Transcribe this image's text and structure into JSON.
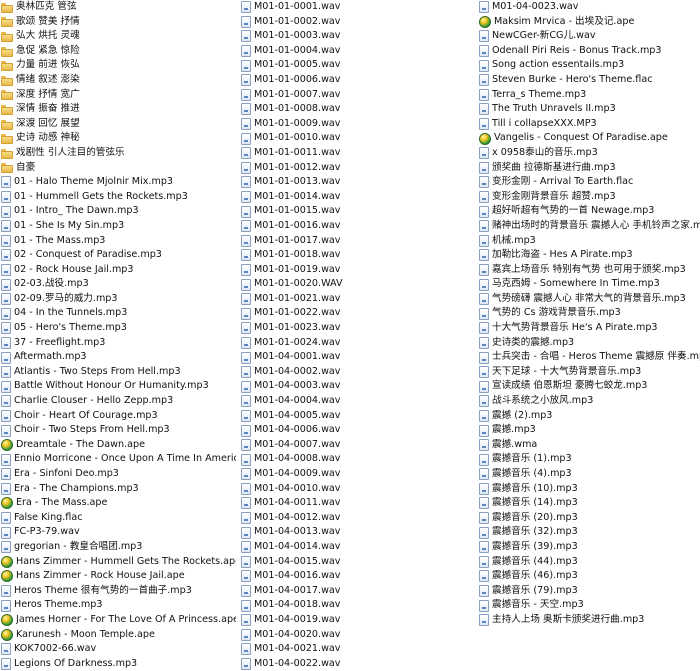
{
  "icons": {
    "folder": "folder-icon",
    "file": "audio-file-icon",
    "ball": "media-player-file-icon"
  },
  "columns": [
    [
      {
        "label": "奥林匹克 管弦",
        "icon": "folder"
      },
      {
        "label": "歌颂 赞美 抒情",
        "icon": "folder"
      },
      {
        "label": "弘大 烘托 灵魂",
        "icon": "folder"
      },
      {
        "label": "急促 紧急 惊险",
        "icon": "folder"
      },
      {
        "label": "力量 前进 恢弘",
        "icon": "folder"
      },
      {
        "label": "情绪 叙述 澎染",
        "icon": "folder"
      },
      {
        "label": "深度 抒情 宽广",
        "icon": "folder"
      },
      {
        "label": "深情 振奋 推进",
        "icon": "folder"
      },
      {
        "label": "深渡 回忆 展望",
        "icon": "folder"
      },
      {
        "label": "史诗 动感 神秘",
        "icon": "folder"
      },
      {
        "label": "戏剧性 引人注目的管弦乐",
        "icon": "folder"
      },
      {
        "label": "自豪",
        "icon": "folder"
      },
      {
        "label": "01 - Halo Theme Mjolnir Mix.mp3",
        "icon": "file"
      },
      {
        "label": "01 - Hummell Gets the Rockets.mp3",
        "icon": "file"
      },
      {
        "label": "01 - Intro_ The Dawn.mp3",
        "icon": "file"
      },
      {
        "label": "01 - She Is My Sin.mp3",
        "icon": "file"
      },
      {
        "label": "01 - The Mass.mp3",
        "icon": "file"
      },
      {
        "label": "02 - Conquest of Paradise.mp3",
        "icon": "file"
      },
      {
        "label": "02 - Rock House Jail.mp3",
        "icon": "file"
      },
      {
        "label": "02-03.战役.mp3",
        "icon": "file"
      },
      {
        "label": "02-09.罗马的威力.mp3",
        "icon": "file"
      },
      {
        "label": "04 - In the Tunnels.mp3",
        "icon": "file"
      },
      {
        "label": "05 - Hero's Theme.mp3",
        "icon": "file"
      },
      {
        "label": "37 - Freeflight.mp3",
        "icon": "file"
      },
      {
        "label": "Aftermath.mp3",
        "icon": "file"
      },
      {
        "label": "Atlantis - Two Steps From Hell.mp3",
        "icon": "file"
      },
      {
        "label": "Battle Without Honour Or Humanity.mp3",
        "icon": "file"
      },
      {
        "label": "Charlie Clouser - Hello Zepp.mp3",
        "icon": "file"
      },
      {
        "label": "Choir - Heart Of Courage.mp3",
        "icon": "file"
      },
      {
        "label": "Choir - Two Steps From Hell.mp3",
        "icon": "file"
      },
      {
        "label": "Dreamtale - The Dawn.ape",
        "icon": "ball"
      },
      {
        "label": "Ennio Morricone - Once Upon A Time In America.mp3",
        "icon": "file"
      },
      {
        "label": "Era - Sinfoni Deo.mp3",
        "icon": "file"
      },
      {
        "label": "Era - The Champions.mp3",
        "icon": "file"
      },
      {
        "label": "Era - The Mass.ape",
        "icon": "ball"
      },
      {
        "label": "False King.flac",
        "icon": "file"
      },
      {
        "label": "FC-P3-79.wav",
        "icon": "file"
      },
      {
        "label": "gregorian - 教皇合唱团.mp3",
        "icon": "file"
      },
      {
        "label": "Hans Zimmer - Hummell Gets The Rockets.ape",
        "icon": "ball"
      },
      {
        "label": "Hans Zimmer - Rock House Jail.ape",
        "icon": "ball"
      },
      {
        "label": "Heros Theme 很有气势的一首曲子.mp3",
        "icon": "file"
      },
      {
        "label": "Heros Theme.mp3",
        "icon": "file"
      },
      {
        "label": "James Horner - For The Love Of A Princess.ape",
        "icon": "ball"
      },
      {
        "label": "Karunesh - Moon Temple.ape",
        "icon": "ball"
      },
      {
        "label": "KOK7002-66.wav",
        "icon": "file"
      },
      {
        "label": "Legions Of Darkness.mp3",
        "icon": "file"
      }
    ],
    [
      {
        "label": "M01-01-0001.wav",
        "icon": "file"
      },
      {
        "label": "M01-01-0002.wav",
        "icon": "file"
      },
      {
        "label": "M01-01-0003.wav",
        "icon": "file"
      },
      {
        "label": "M01-01-0004.wav",
        "icon": "file"
      },
      {
        "label": "M01-01-0005.wav",
        "icon": "file"
      },
      {
        "label": "M01-01-0006.wav",
        "icon": "file"
      },
      {
        "label": "M01-01-0007.wav",
        "icon": "file"
      },
      {
        "label": "M01-01-0008.wav",
        "icon": "file"
      },
      {
        "label": "M01-01-0009.wav",
        "icon": "file"
      },
      {
        "label": "M01-01-0010.wav",
        "icon": "file"
      },
      {
        "label": "M01-01-0011.wav",
        "icon": "file"
      },
      {
        "label": "M01-01-0012.wav",
        "icon": "file"
      },
      {
        "label": "M01-01-0013.wav",
        "icon": "file"
      },
      {
        "label": "M01-01-0014.wav",
        "icon": "file"
      },
      {
        "label": "M01-01-0015.wav",
        "icon": "file"
      },
      {
        "label": "M01-01-0016.wav",
        "icon": "file"
      },
      {
        "label": "M01-01-0017.wav",
        "icon": "file"
      },
      {
        "label": "M01-01-0018.wav",
        "icon": "file"
      },
      {
        "label": "M01-01-0019.wav",
        "icon": "file"
      },
      {
        "label": "M01-01-0020.WAV",
        "icon": "file"
      },
      {
        "label": "M01-01-0021.wav",
        "icon": "file"
      },
      {
        "label": "M01-01-0022.wav",
        "icon": "file"
      },
      {
        "label": "M01-01-0023.wav",
        "icon": "file"
      },
      {
        "label": "M01-01-0024.wav",
        "icon": "file"
      },
      {
        "label": "M01-04-0001.wav",
        "icon": "file"
      },
      {
        "label": "M01-04-0002.wav",
        "icon": "file"
      },
      {
        "label": "M01-04-0003.wav",
        "icon": "file"
      },
      {
        "label": "M01-04-0004.wav",
        "icon": "file"
      },
      {
        "label": "M01-04-0005.wav",
        "icon": "file"
      },
      {
        "label": "M01-04-0006.wav",
        "icon": "file"
      },
      {
        "label": "M01-04-0007.wav",
        "icon": "file"
      },
      {
        "label": "M01-04-0008.wav",
        "icon": "file"
      },
      {
        "label": "M01-04-0009.wav",
        "icon": "file"
      },
      {
        "label": "M01-04-0010.wav",
        "icon": "file"
      },
      {
        "label": "M01-04-0011.wav",
        "icon": "file"
      },
      {
        "label": "M01-04-0012.wav",
        "icon": "file"
      },
      {
        "label": "M01-04-0013.wav",
        "icon": "file"
      },
      {
        "label": "M01-04-0014.wav",
        "icon": "file"
      },
      {
        "label": "M01-04-0015.wav",
        "icon": "file"
      },
      {
        "label": "M01-04-0016.wav",
        "icon": "file"
      },
      {
        "label": "M01-04-0017.wav",
        "icon": "file"
      },
      {
        "label": "M01-04-0018.wav",
        "icon": "file"
      },
      {
        "label": "M01-04-0019.wav",
        "icon": "file"
      },
      {
        "label": "M01-04-0020.wav",
        "icon": "file"
      },
      {
        "label": "M01-04-0021.wav",
        "icon": "file"
      },
      {
        "label": "M01-04-0022.wav",
        "icon": "file"
      }
    ],
    [
      {
        "label": "M01-04-0023.wav",
        "icon": "file"
      },
      {
        "label": "Maksim Mrvica - 出埃及记.ape",
        "icon": "ball"
      },
      {
        "label": "NewCGer-新CG儿.wav",
        "icon": "file"
      },
      {
        "label": "Odenall Piri Reis - Bonus Track.mp3",
        "icon": "file"
      },
      {
        "label": "Song action essentails.mp3",
        "icon": "file"
      },
      {
        "label": "Steven Burke - Hero's Theme.flac",
        "icon": "file"
      },
      {
        "label": "Terra_s Theme.mp3",
        "icon": "file"
      },
      {
        "label": "The Truth Unravels II.mp3",
        "icon": "file"
      },
      {
        "label": "Till i collapseXXX.MP3",
        "icon": "file"
      },
      {
        "label": "Vangelis - Conquest Of Paradise.ape",
        "icon": "ball"
      },
      {
        "label": "x  0958泰山的音乐.mp3",
        "icon": "file"
      },
      {
        "label": "颁奖曲   拉德斯基进行曲.mp3",
        "icon": "file"
      },
      {
        "label": "变形金刚 - Arrival To Earth.flac",
        "icon": "file"
      },
      {
        "label": "变形金刚背景音乐 超赞.mp3",
        "icon": "file"
      },
      {
        "label": "超好听超有气势的一首 Newage.mp3",
        "icon": "file"
      },
      {
        "label": "赌神出场时的背景音乐 震撼人心 手机铃声之家.mp3",
        "icon": "file"
      },
      {
        "label": "机械.mp3",
        "icon": "file"
      },
      {
        "label": "加勒比海盗 - Hes A Pirate.mp3",
        "icon": "file"
      },
      {
        "label": "嘉宾上场音乐 特别有气势 也可用于颁奖.mp3",
        "icon": "file"
      },
      {
        "label": "马克西姆 - Somewhere In Time.mp3",
        "icon": "file"
      },
      {
        "label": "气势磅礴 震撼人心 非常大气的背景音乐.mp3",
        "icon": "file"
      },
      {
        "label": "气势的 Cs 游戏背景音乐.mp3",
        "icon": "file"
      },
      {
        "label": "十大气势背景音乐 He's A Pirate.mp3",
        "icon": "file"
      },
      {
        "label": "史诗类的震撼.mp3",
        "icon": "file"
      },
      {
        "label": "士兵突击 - 合唱 - Heros Theme 震撼原 伴奏.mp3",
        "icon": "file"
      },
      {
        "label": "天下足球 - 十大气势背景音乐.mp3",
        "icon": "file"
      },
      {
        "label": "宣读成绩  伯恩斯坦 豪腾七蛟龙.mp3",
        "icon": "file"
      },
      {
        "label": "战斗系统之小放风.mp3",
        "icon": "file"
      },
      {
        "label": "震撼 (2).mp3",
        "icon": "file"
      },
      {
        "label": "震撼.mp3",
        "icon": "file"
      },
      {
        "label": "震撼.wma",
        "icon": "file"
      },
      {
        "label": "震撼音乐 (1).mp3",
        "icon": "file"
      },
      {
        "label": "震撼音乐 (4).mp3",
        "icon": "file"
      },
      {
        "label": "震撼音乐 (10).mp3",
        "icon": "file"
      },
      {
        "label": "震撼音乐 (14).mp3",
        "icon": "file"
      },
      {
        "label": "震撼音乐 (20).mp3",
        "icon": "file"
      },
      {
        "label": "震撼音乐 (32).mp3",
        "icon": "file"
      },
      {
        "label": "震撼音乐 (39).mp3",
        "icon": "file"
      },
      {
        "label": "震撼音乐 (44).mp3",
        "icon": "file"
      },
      {
        "label": "震撼音乐 (46).mp3",
        "icon": "file"
      },
      {
        "label": "震撼音乐 (79).mp3",
        "icon": "file"
      },
      {
        "label": "震撼音乐 - 天空.mp3",
        "icon": "file"
      },
      {
        "label": "主持人上场   奥斯卡颁奖进行曲.mp3",
        "icon": "file"
      }
    ]
  ]
}
